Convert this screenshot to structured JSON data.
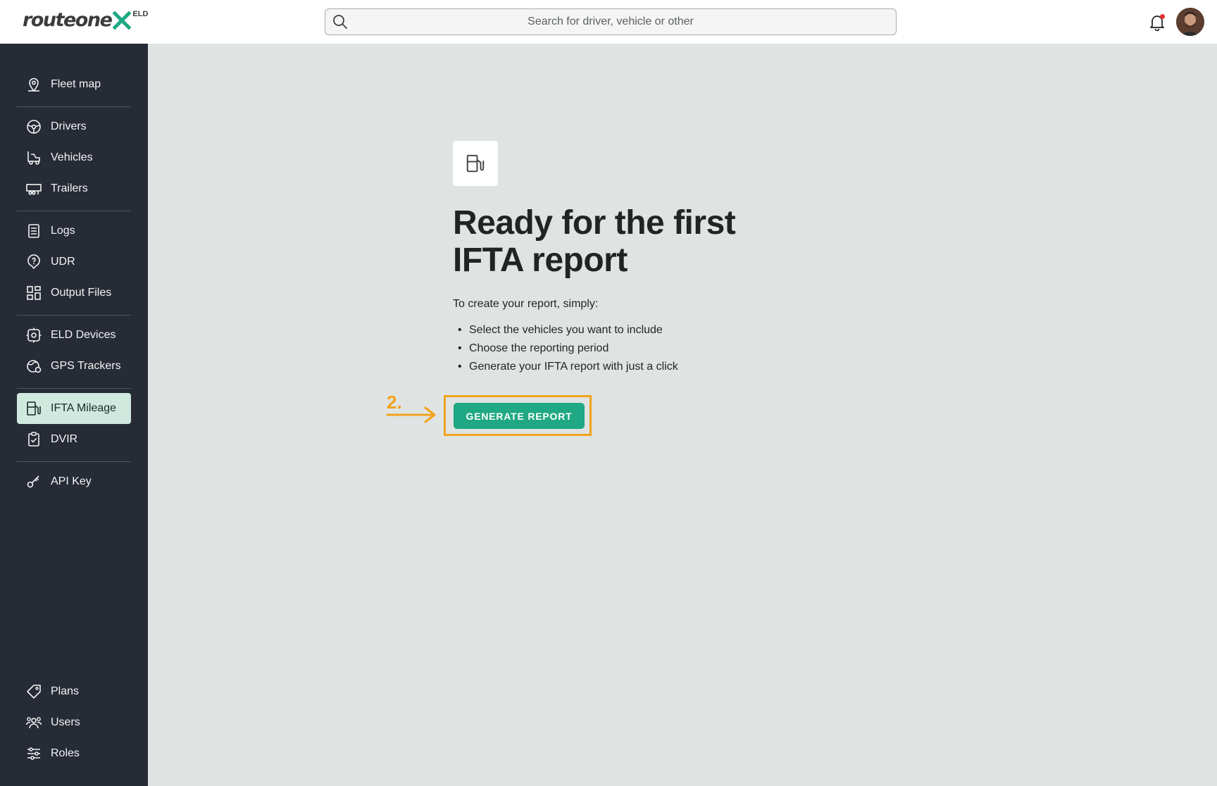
{
  "header": {
    "logo_text": "routeone",
    "logo_badge": "ELD",
    "search_placeholder": "Search for driver, vehicle or other"
  },
  "sidebar": {
    "items": [
      {
        "label": "Fleet map",
        "icon": "location-pin-icon"
      },
      {
        "label": "Drivers",
        "icon": "steering-wheel-icon"
      },
      {
        "label": "Vehicles",
        "icon": "truck-icon"
      },
      {
        "label": "Trailers",
        "icon": "trailer-icon"
      },
      {
        "label": "Logs",
        "icon": "clipboard-list-icon"
      },
      {
        "label": "UDR",
        "icon": "question-pin-icon"
      },
      {
        "label": "Output Files",
        "icon": "grid-files-icon"
      },
      {
        "label": "ELD Devices",
        "icon": "device-gear-icon"
      },
      {
        "label": "GPS Trackers",
        "icon": "globe-tracker-icon"
      },
      {
        "label": "IFTA Mileage",
        "icon": "fuel-pump-icon"
      },
      {
        "label": "DVIR",
        "icon": "clipboard-check-icon"
      },
      {
        "label": "API Key",
        "icon": "key-icon"
      },
      {
        "label": "Plans",
        "icon": "tag-icon"
      },
      {
        "label": "Users",
        "icon": "users-icon"
      },
      {
        "label": "Roles",
        "icon": "sliders-icon"
      }
    ],
    "active": "IFTA Mileage"
  },
  "main": {
    "title_line1": "Ready for the first",
    "title_line2": "IFTA report",
    "intro": "To create your report, simply:",
    "steps": [
      "Select the vehicles you want to include",
      "Choose the reporting period",
      "Generate your IFTA report with just a click"
    ],
    "generate_button": "GENERATE REPORT",
    "annotation_step": "2."
  },
  "colors": {
    "accent": "#1fa883",
    "sidebar_bg": "#262b36",
    "active_bg": "#cfe9df",
    "annotation": "#f2a21c",
    "page_bg": "#dfe4e2"
  }
}
